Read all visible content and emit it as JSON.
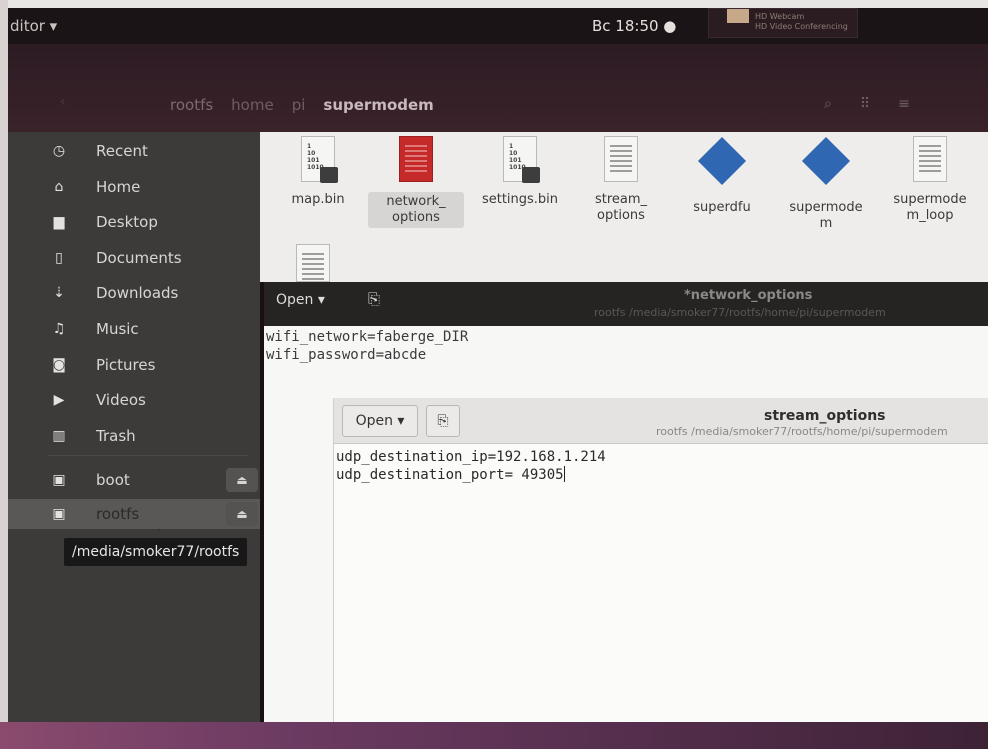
{
  "topbar": {
    "app_menu": "ditor ▾",
    "clock": "Bc 18:50 ●"
  },
  "headerbar": {
    "breadcrumbs": [
      "rootfs",
      "home",
      "pi",
      "supermodem"
    ]
  },
  "sidebar": {
    "items": [
      {
        "label": "Recent",
        "icon": "clock-icon",
        "glyph": "◷"
      },
      {
        "label": "Home",
        "icon": "home-icon",
        "glyph": "⌂"
      },
      {
        "label": "Desktop",
        "icon": "folder-icon",
        "glyph": "▆"
      },
      {
        "label": "Documents",
        "icon": "document-icon",
        "glyph": "▯"
      },
      {
        "label": "Downloads",
        "icon": "download-icon",
        "glyph": "⇣"
      },
      {
        "label": "Music",
        "icon": "music-icon",
        "glyph": "♫"
      },
      {
        "label": "Pictures",
        "icon": "camera-icon",
        "glyph": "◙"
      },
      {
        "label": "Videos",
        "icon": "video-icon",
        "glyph": "▶"
      },
      {
        "label": "Trash",
        "icon": "trash-icon",
        "glyph": "▥"
      }
    ],
    "devices": [
      {
        "label": "boot",
        "icon": "drive-icon",
        "glyph": "▣",
        "eject": "⏏"
      },
      {
        "label": "rootfs",
        "icon": "drive-icon",
        "glyph": "▣",
        "eject": "⏏"
      }
    ],
    "tooltip": "/media/smoker77/rootfs"
  },
  "files": [
    {
      "name": "map.bin",
      "type": "binary-locked"
    },
    {
      "name": "network_\noptions",
      "type": "text-red"
    },
    {
      "name": "settings.bin",
      "type": "binary-locked"
    },
    {
      "name": "stream_\noptions",
      "type": "text"
    },
    {
      "name": "superdfu",
      "type": "executable"
    },
    {
      "name": "supermode\nm",
      "type": "executable"
    },
    {
      "name": "supermode\nm_loop",
      "type": "text"
    }
  ],
  "binary_digits": "1\n10\n101\n1010",
  "editor1": {
    "open_label": "Open ▾",
    "title": "*network_options",
    "subtitle": "rootfs /media/smoker77/rootfs/home/pi/supermodem",
    "lines": [
      "wifi_network=faberge_DIR",
      "wifi_password=abcde"
    ]
  },
  "editor2": {
    "open_label": "Open ▾",
    "title": "stream_options",
    "subtitle": "rootfs /media/smoker77/rootfs/home/pi/supermodem",
    "lines": [
      "udp_destination_ip=192.168.1.214",
      "udp_destination_port= 49305"
    ]
  },
  "webcam_text": "HD Webcam\nHD Video Conferencing"
}
